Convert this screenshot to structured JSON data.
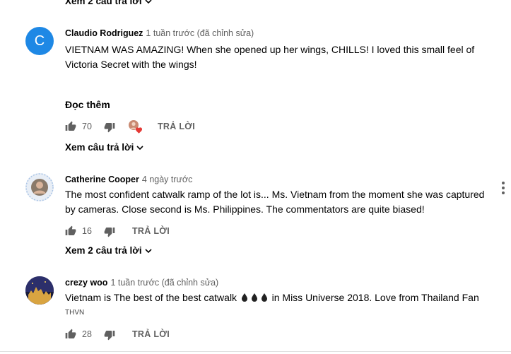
{
  "top_replies_toggle": {
    "label": "Xem 2 câu trả lời"
  },
  "comments": [
    {
      "avatar_letter": "C",
      "avatar_color": "#1e88e5",
      "author": "Claudio Rodriguez",
      "time": "1 tuần trước (đã chỉnh sửa)",
      "text": "VIETNAM WAS AMAZING! When she opened up her wings, CHILLS! I loved this small feel of Victoria Secret with the wings!",
      "read_more": "Đọc thêm",
      "likes": "70",
      "reply_label": "TRẢ LỜI",
      "replies_toggle": "Xem câu trả lời"
    },
    {
      "author": "Catherine Cooper",
      "time": "4 ngày trước",
      "text": "The most confident catwalk ramp of the lot is... Ms. Vietnam from the moment she was captured by cameras. Close second is Ms. Philippines. The commentators are quite biased!",
      "likes": "16",
      "reply_label": "TRẢ LỜI",
      "replies_toggle": "Xem 2 câu trả lời"
    },
    {
      "author": "crezy woo",
      "time": "1 tuần trước (đã chỉnh sửa)",
      "text": "Vietnam is The best of the best catwalk",
      "text_after_emoji": "in Miss Universe 2018. Love from Thailand Fan",
      "sub_text": "THVN",
      "likes": "28",
      "reply_label": "TRẢ LỜI"
    }
  ],
  "colors": {
    "heart": "#e53935",
    "icon": "#606060",
    "divider": "#e0e0e0"
  }
}
